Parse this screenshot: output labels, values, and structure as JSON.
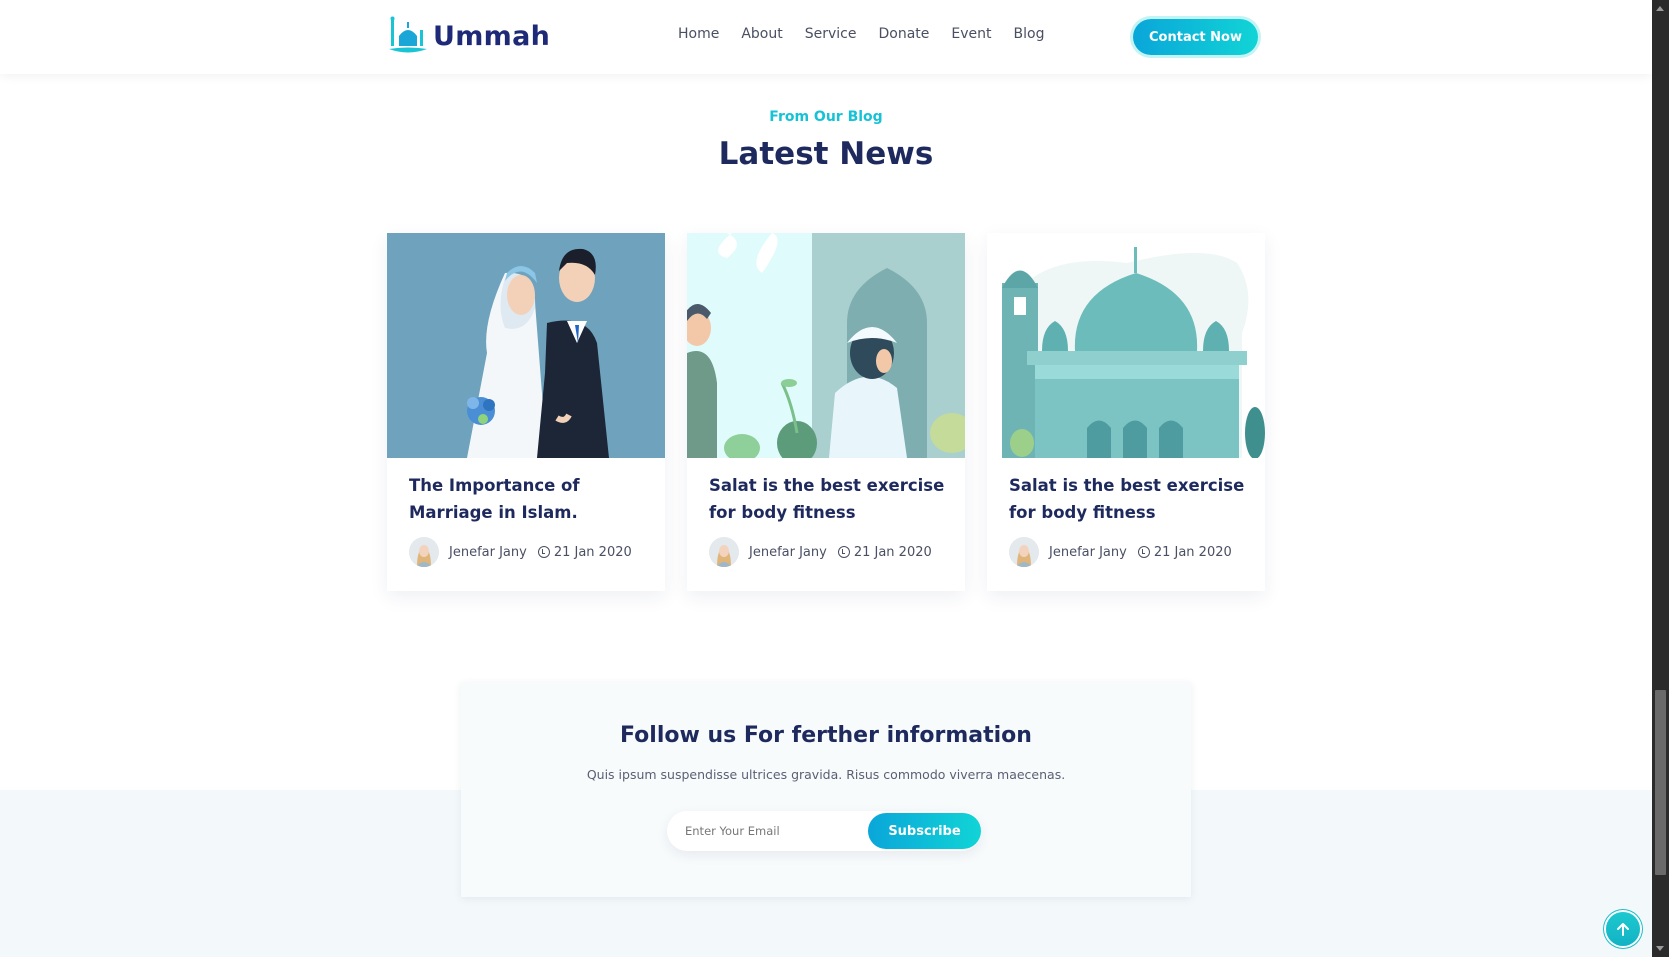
{
  "brand": {
    "name": "Ummah",
    "accent": "#11d4d6",
    "navy": "#1e2a5e"
  },
  "nav": {
    "items": [
      "Home",
      "About",
      "Service",
      "Donate",
      "Event",
      "Blog"
    ],
    "cta_label": "Contact Now"
  },
  "section": {
    "eyebrow": "From Our Blog",
    "title": "Latest News"
  },
  "posts": [
    {
      "title": "The Importance of Marriage in Islam.",
      "author": "Jenefar Jany",
      "date": "21 Jan 2020",
      "image_icon": "wedding-couple-illustration"
    },
    {
      "title": "Salat is the best exercise for body fitness",
      "author": "Jenefar Jany",
      "date": "21 Jan 2020",
      "image_icon": "prayer-boy-illustration"
    },
    {
      "title": "Salat is the best exercise for body fitness",
      "author": "Jenefar Jany",
      "date": "21 Jan 2020",
      "image_icon": "mosque-illustration"
    }
  ],
  "newsletter": {
    "title": "Follow us For ferther information",
    "subtitle": "Quis ipsum suspendisse ultrices gravida. Risus commodo viverra maecenas.",
    "placeholder": "Enter Your Email",
    "button_label": "Subscribe"
  }
}
